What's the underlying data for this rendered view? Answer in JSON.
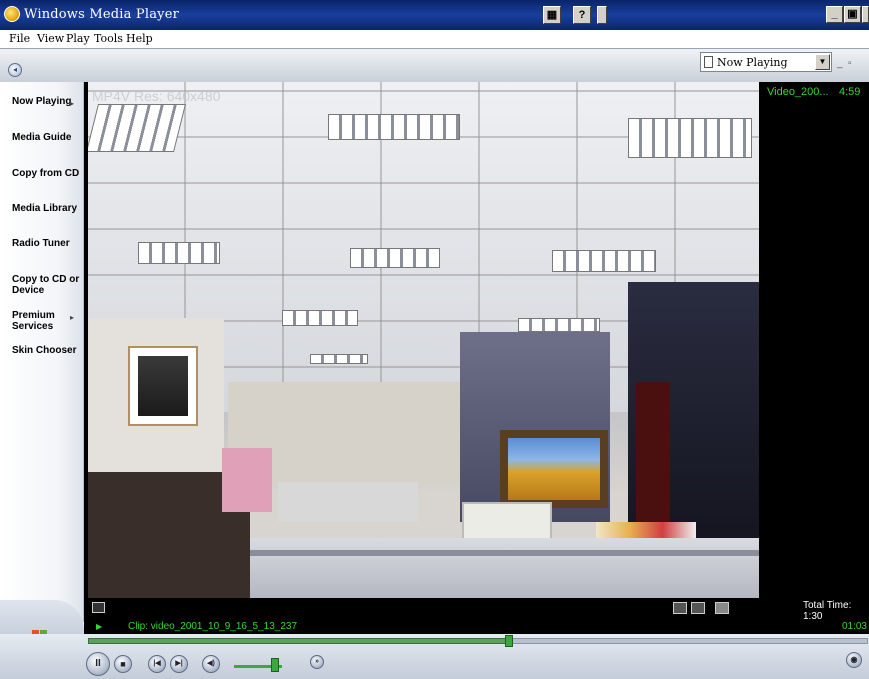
{
  "window": {
    "title": "Windows Media Player",
    "buttons": {
      "minimize": "_",
      "maximize": "▣",
      "close": "X",
      "mini_mode": "▦",
      "help": "?"
    }
  },
  "menu": [
    "File",
    "View",
    "Play",
    "Tools",
    "Help"
  ],
  "nav": {
    "now_playing_select": "Now Playing",
    "items": [
      {
        "label": "Now Playing",
        "has_arrow": true
      },
      {
        "label": "Media Guide",
        "has_arrow": false
      },
      {
        "label": "Copy from CD",
        "has_arrow": false
      },
      {
        "label": "Media Library",
        "has_arrow": false
      },
      {
        "label": "Radio Tuner",
        "has_arrow": false
      },
      {
        "label": "Copy to CD or Device",
        "has_arrow": false
      },
      {
        "label": "Premium Services",
        "has_arrow": true
      },
      {
        "label": "Skin Chooser",
        "has_arrow": false
      }
    ]
  },
  "video": {
    "osd_text": "MP4V Res: 640x480"
  },
  "playlist": {
    "items": [
      {
        "name": "Video_200...",
        "duration": "4:59"
      }
    ],
    "total_time": "Total Time: 1:30"
  },
  "status": {
    "clip": "Clip: video_2001_10_9_16_5_13_237",
    "time": "01:03"
  },
  "controls": {
    "pause": "II",
    "stop": "■",
    "prev": "|◀",
    "next": "▶|",
    "mute": "◀)",
    "progress": 0.54,
    "volume": 0.85
  },
  "colors": {
    "accent_green": "#36d636",
    "titlebar": "#0a246a"
  }
}
